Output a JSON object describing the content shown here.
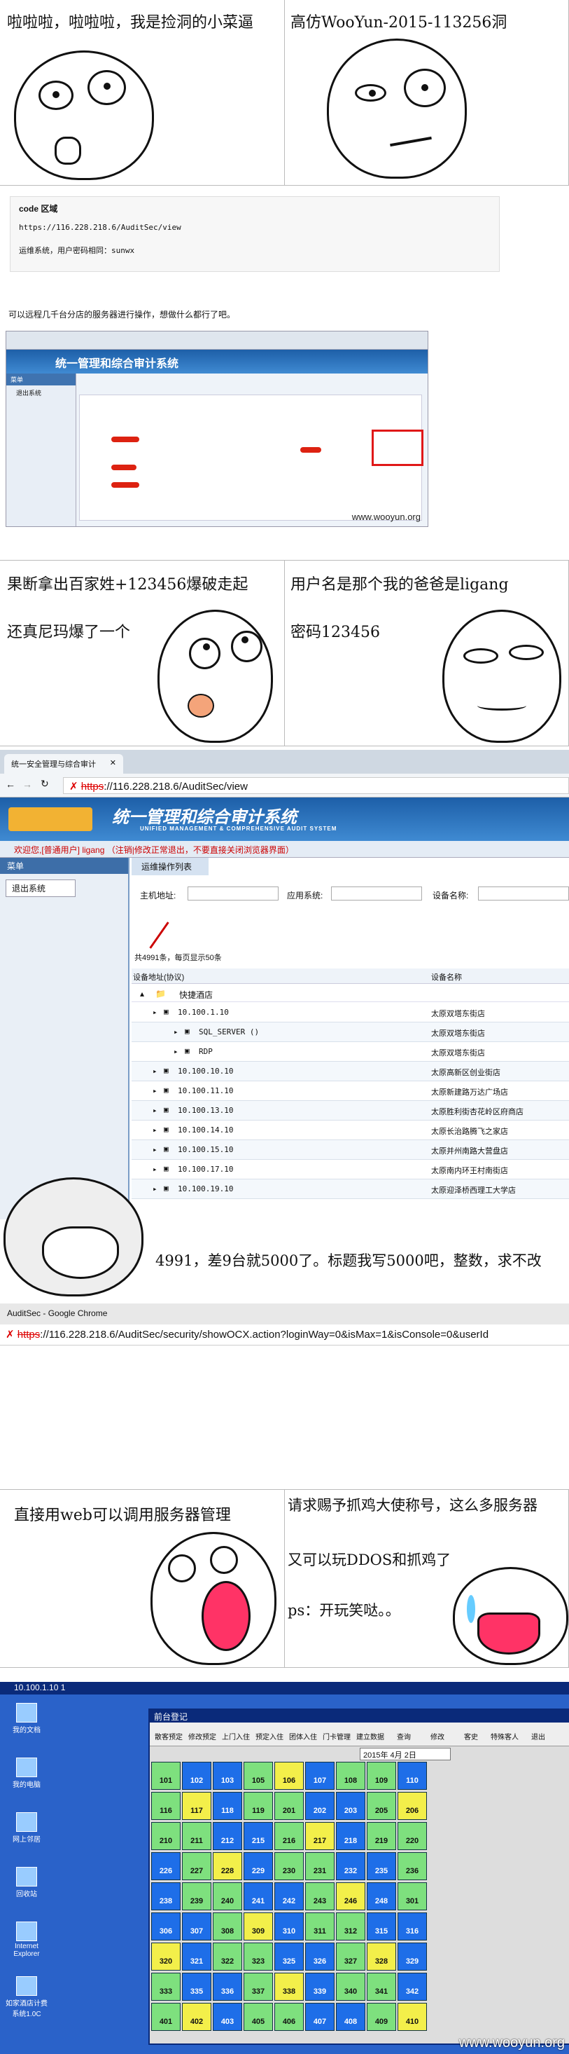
{
  "panels": {
    "p1_left": "啦啦啦，啦啦啦，我是捡洞的小菜逼",
    "p1_right": "高仿WooYun-2015-113256洞",
    "code_header": "code 区域",
    "code_line1": "https://116.228.218.6/AuditSec/view",
    "code_line2": "运维系统，用户密码相同：sunwx",
    "caption_remote": "可以远程几千台分店的服务器进行操作，想做什么都行了吧。",
    "p3_left_line1": "果断拿出百家姓+123456爆破走起",
    "p3_left_line2": "还真尼玛爆了一个",
    "p3_right_line1": "用户名是那个我的爸爸是ligang",
    "p3_right_line2": "密码123456",
    "p4_count_caption": "4991，差9台就5000了。标题我写5000吧，整数，求不改",
    "p5_left": "直接用web可以调用服务器管理",
    "p5_right_line1": "请求赐予抓鸡大使称号，这么多服务器",
    "p5_right_line2": "又可以玩DDOS和抓鸡了",
    "p5_right_line3": "ps：开玩笑哒。。"
  },
  "shot_small": {
    "title": "统一管理和综合审计系统",
    "menu": "菜单",
    "logout": "退出系统",
    "watermark": "www.wooyun.org"
  },
  "shot_big": {
    "tab_title": "统一安全管理与综合审计",
    "url_prefix": "https",
    "url_rest": "://116.228.218.6/AuditSec/view",
    "sys_title": "统一管理和综合审计系统",
    "sys_subtitle": "UNIFIED MANAGEMENT & COMPREHENSIVE AUDIT SYSTEM",
    "welcome": "欢迎您,[普通用户] ligang （注销|修改正常退出，不要直接关闭浏览器界面）",
    "menu": "菜单",
    "logout": "退出系统",
    "panel_tab": "运维操作列表",
    "host_label": "主机地址:",
    "app_label": "应用系统:",
    "device_label": "设备名称:",
    "total": "共4991条，每页显示50条",
    "col_addr": "设备地址(协议)",
    "col_name": "设备名称",
    "group": "快捷酒店",
    "rows": [
      {
        "addr": "10.100.1.10",
        "name": "太原双塔东街店"
      },
      {
        "addr": "SQL_SERVER  ()",
        "name": "太原双塔东街店"
      },
      {
        "addr": "RDP",
        "name": "太原双塔东街店"
      },
      {
        "addr": "10.100.10.10",
        "name": "太原高新区创业街店"
      },
      {
        "addr": "10.100.11.10",
        "name": "太原新建路万达广场店"
      },
      {
        "addr": "10.100.13.10",
        "name": "太原胜利街杏花岭区府商店"
      },
      {
        "addr": "10.100.14.10",
        "name": "太原长治路腾飞之家店"
      },
      {
        "addr": "10.100.15.10",
        "name": "太原并州南路大营盘店"
      },
      {
        "addr": "10.100.17.10",
        "name": "太原南内环王村南街店"
      },
      {
        "addr": "10.100.19.10",
        "name": "太原迎泽桥西理工大学店"
      }
    ]
  },
  "chrome_bar": {
    "window_title": "AuditSec - Google Chrome",
    "url_prefix": "https",
    "url_rest": "://116.228.218.6/AuditSec/security/showOCX.action?loginWay=0&isMax=1&isConsole=0&userId"
  },
  "remote_desktop": {
    "titlebar": "10.100.1.10 1",
    "app_title": "前台登记",
    "date": "2015年 4月 2日",
    "desktop_icons": [
      "我的文档",
      "我的电脑",
      "网上邻居",
      "回收站",
      "Internet Explorer",
      "如家酒店计费系统1.0C"
    ],
    "toolbar": [
      "散客预定",
      "修改预定",
      "上门入住",
      "预定入住",
      "团体入住",
      "门卡管理",
      "建立数据",
      "查询",
      "修改",
      "客史",
      "特殊客人",
      "退出"
    ],
    "room_rows": [
      [
        "101",
        "102",
        "103",
        "105",
        "106",
        "107",
        "108",
        "109",
        "110"
      ],
      [
        "116",
        "117",
        "118",
        "119",
        "201",
        "202",
        "203",
        "205",
        "206"
      ],
      [
        "210",
        "211",
        "212",
        "215",
        "216",
        "217",
        "218",
        "219",
        "220"
      ],
      [
        "226",
        "227",
        "228",
        "229",
        "230",
        "231",
        "232",
        "235",
        "236"
      ],
      [
        "238",
        "239",
        "240",
        "241",
        "242",
        "243",
        "246",
        "248",
        "301"
      ],
      [
        "306",
        "307",
        "308",
        "309",
        "310",
        "311",
        "312",
        "315",
        "316"
      ],
      [
        "320",
        "321",
        "322",
        "323",
        "325",
        "326",
        "327",
        "328",
        "329"
      ],
      [
        "333",
        "335",
        "336",
        "337",
        "338",
        "339",
        "340",
        "341",
        "342"
      ],
      [
        "401",
        "402",
        "403",
        "405",
        "406",
        "407",
        "408",
        "409",
        "410"
      ]
    ],
    "watermark": "www.wooyun.org"
  },
  "colors": {
    "room_blue": "#1e6ee8",
    "room_green": "#7ee07e",
    "room_yellow": "#f3ef4a",
    "desktop_blue": "#2a62c9",
    "red_box": "#e01818"
  }
}
